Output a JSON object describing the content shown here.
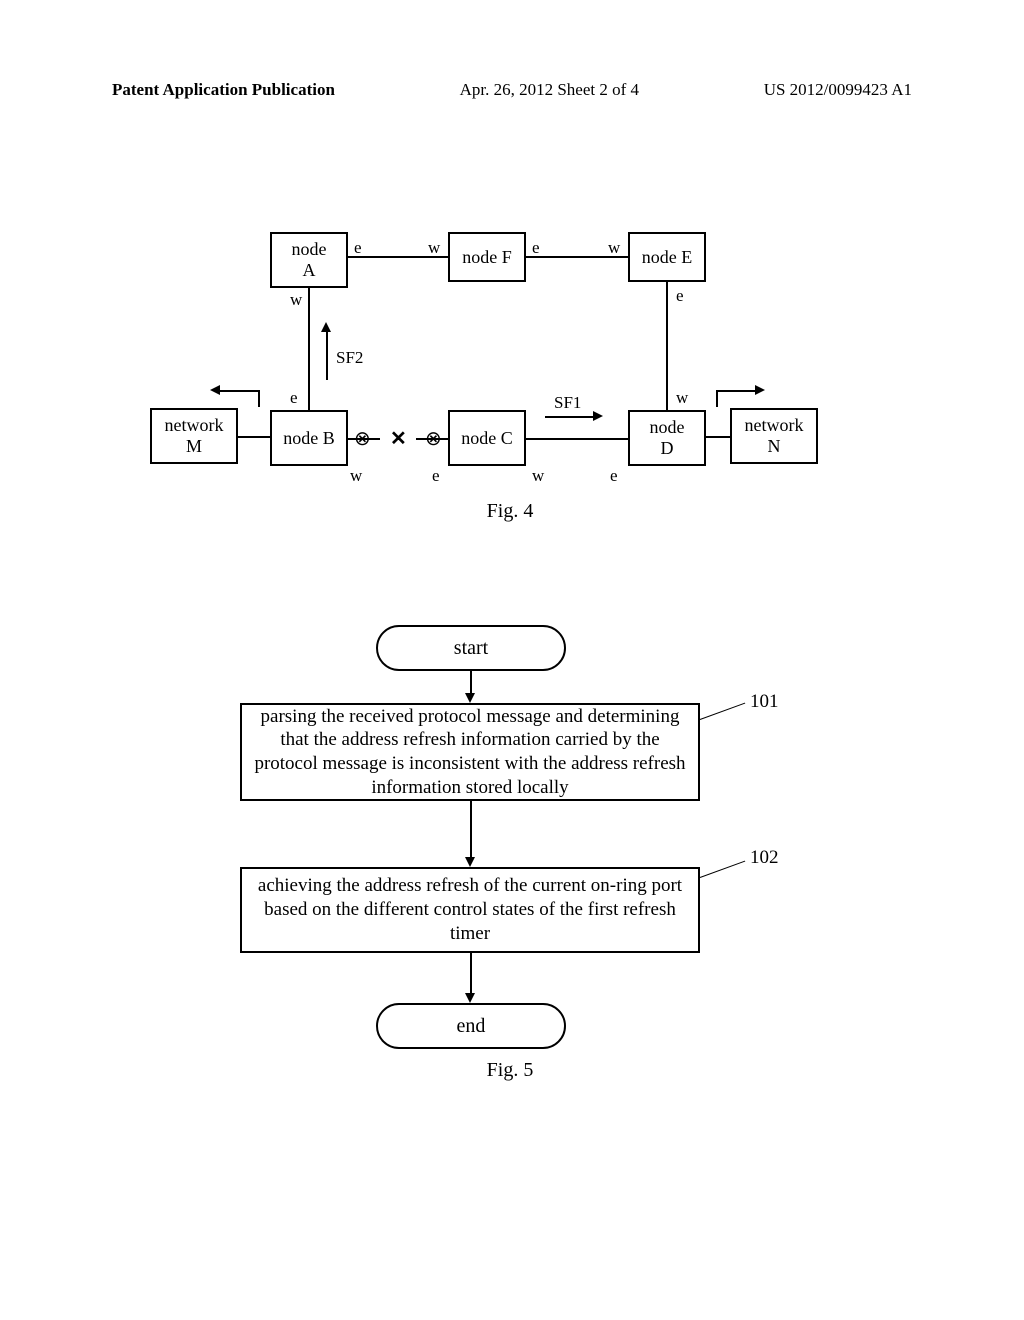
{
  "header": {
    "left": "Patent Application Publication",
    "mid": "Apr. 26, 2012  Sheet 2 of 4",
    "right": "US 2012/0099423 A1"
  },
  "fig4": {
    "nodes": {
      "A": "node\nA",
      "B": "node B",
      "C": "node C",
      "D": "node\nD",
      "E": "node E",
      "F": "node F",
      "M": "network\nM",
      "N": "network\nN"
    },
    "ports": {
      "e": "e",
      "w": "w"
    },
    "labels": {
      "sf1": "SF1",
      "sf2": "SF2"
    },
    "fault_mark": "✕",
    "blocked_port_glyph": "⊗",
    "caption": "Fig. 4"
  },
  "fig5": {
    "start": "start",
    "step101": "parsing the received protocol message and determining that the address refresh information carried by the protocol message is inconsistent with the address refresh information stored locally",
    "step102": "achieving the address refresh of the current on-ring port based on the different control states of the first refresh timer",
    "end": "end",
    "ref101": "101",
    "ref102": "102",
    "caption": "Fig. 5"
  }
}
